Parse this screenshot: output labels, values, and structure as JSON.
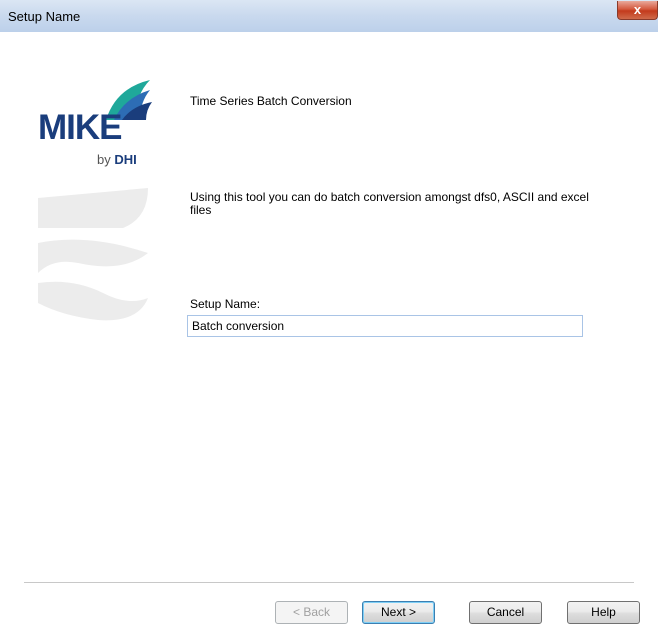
{
  "window": {
    "title": "Setup Name",
    "close_label": "x"
  },
  "logo": {
    "brand": "MIKE",
    "by": "by",
    "company": "DHI"
  },
  "main": {
    "heading": "Time Series Batch Conversion",
    "info": "Using this tool you can do batch conversion amongst dfs0, ASCII and excel files",
    "setup_label": "Setup Name:",
    "setup_value": "Batch conversion"
  },
  "buttons": {
    "back": "< Back",
    "next": "Next >",
    "cancel": "Cancel",
    "help": "Help"
  },
  "colors": {
    "brand_blue": "#1a3d7c",
    "accent_teal": "#1fa89a",
    "close_red": "#c33b1c"
  }
}
